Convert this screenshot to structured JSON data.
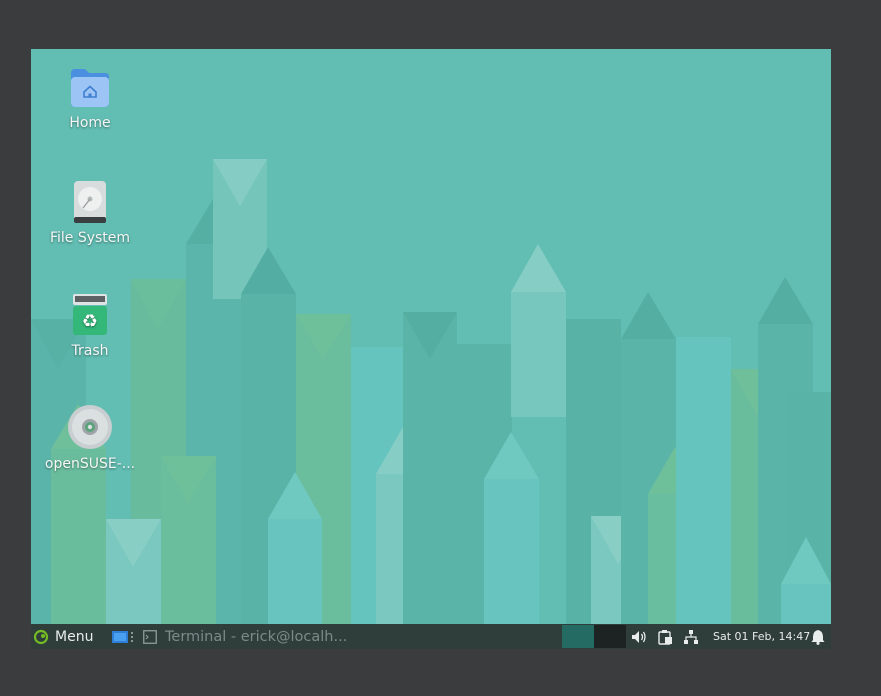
{
  "desktop": {
    "icons": [
      {
        "label": "Home",
        "icon": "home-folder-icon"
      },
      {
        "label": "File System",
        "icon": "hard-drive-icon"
      },
      {
        "label": "Trash",
        "icon": "trash-icon"
      },
      {
        "label": "openSUSE-...",
        "icon": "optical-disc-icon"
      }
    ]
  },
  "panel": {
    "menu_label": "Menu",
    "menu_icon": "opensuse-logo-icon",
    "window_button_label": "Terminal - erick@localh...",
    "window_button_icon": "terminal-icon",
    "clock": "Sat 01 Feb, 14:47",
    "tray_icons": [
      "volume-icon",
      "clipboard-icon",
      "network-icon",
      "notification-bell-icon"
    ],
    "colors": {
      "panel_bg": "#2f3d3b",
      "desktop_bg": "#62bdb2",
      "active_workspace": "#236b63"
    }
  }
}
